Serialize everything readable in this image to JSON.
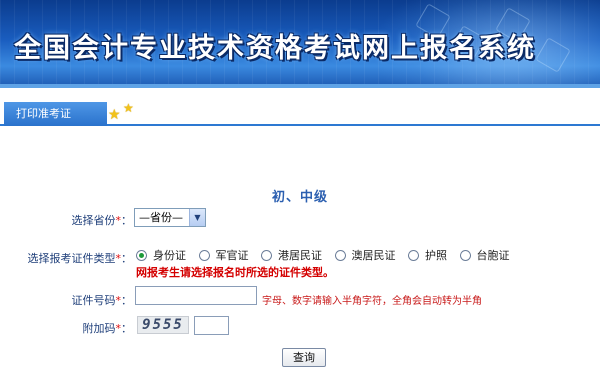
{
  "banner": {
    "title": "全国会计专业技术资格考试网上报名系统"
  },
  "tabs": [
    {
      "label": "打印准考证"
    }
  ],
  "section": {
    "title": "初、中级"
  },
  "form": {
    "province": {
      "label": "选择省份",
      "required_mark": "*",
      "colon": "：",
      "selected": "—省份—"
    },
    "id_type": {
      "label": "选择报考证件类型",
      "required_mark": "*",
      "colon": "：",
      "options": [
        "身份证",
        "军官证",
        "港居民证",
        "澳居民证",
        "护照",
        "台胞证"
      ],
      "selected_index": 0,
      "warning": "网报考生请选择报名时所选的证件类型。"
    },
    "id_number": {
      "label": "证件号码",
      "required_mark": "*",
      "colon": "：",
      "value": "",
      "hint": "字母、数字请输入半角字符，全角会自动转为半角"
    },
    "captcha": {
      "label": "附加码",
      "required_mark": "*",
      "colon": "：",
      "image_text": "9555",
      "value": ""
    },
    "submit_label": "查询"
  },
  "colors": {
    "banner": "#1a5dbf",
    "tab": "#2a72cc",
    "warning": "#d40000",
    "hint": "#c81a1a",
    "required": "#e01010",
    "radio_checked": "#1d9a3a"
  }
}
